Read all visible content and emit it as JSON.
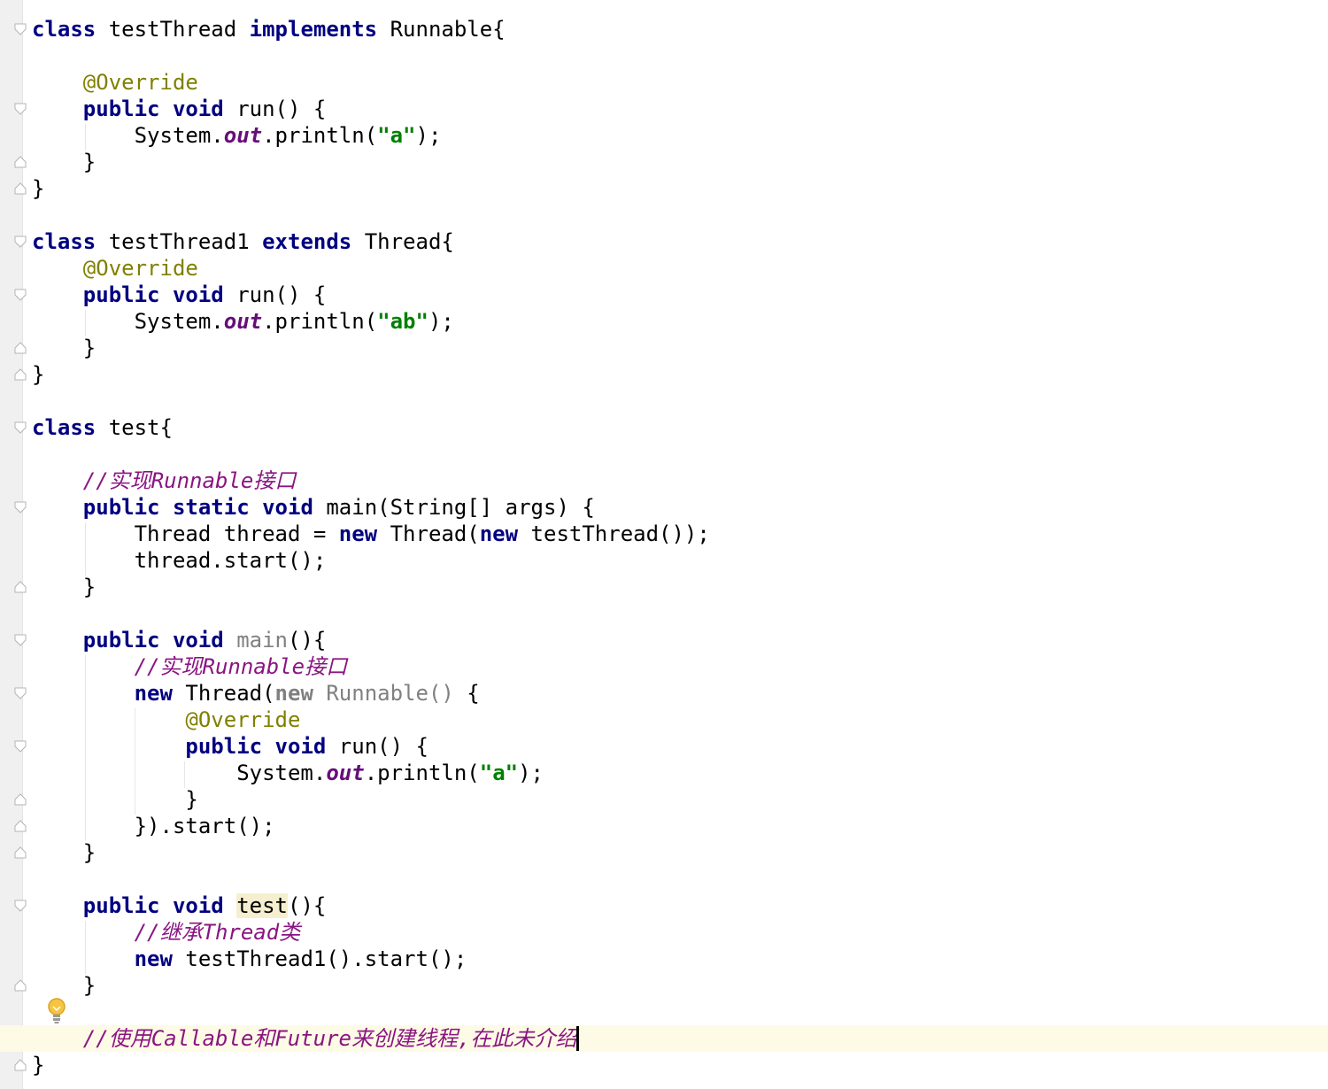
{
  "code": {
    "l1": {
      "kw1": "class",
      "t1": " testThread ",
      "kw2": "implements",
      "t2": " Runnable{"
    },
    "l3": {
      "ann": "@Override"
    },
    "l4": {
      "kw1": "public",
      "sp": " ",
      "kw2": "void",
      "t": " run() {"
    },
    "l5": {
      "t1": "System.",
      "field": "out",
      "t2": ".println(",
      "str": "\"a\"",
      "t3": ");"
    },
    "l6": {
      "t": "}"
    },
    "l7": {
      "t": "}"
    },
    "l9": {
      "kw1": "class",
      "t1": " testThread1 ",
      "kw2": "extends",
      "t2": " Thread{"
    },
    "l10": {
      "ann": "@Override"
    },
    "l11": {
      "kw1": "public",
      "sp": " ",
      "kw2": "void",
      "t": " run() {"
    },
    "l12": {
      "t1": "System.",
      "field": "out",
      "t2": ".println(",
      "str": "\"ab\"",
      "t3": ");"
    },
    "l13": {
      "t": "}"
    },
    "l14": {
      "t": "}"
    },
    "l16": {
      "kw1": "class",
      "t1": " test{"
    },
    "l18": {
      "cmt": "//实现Runnable接口"
    },
    "l19": {
      "kw1": "public",
      "kw2": "static",
      "kw3": "void",
      "t": " main(String[] args) {"
    },
    "l20": {
      "t1": "Thread thread = ",
      "kw1": "new",
      "t2": " Thread(",
      "kw2": "new",
      "t3": " testThread());"
    },
    "l21": {
      "t": "thread.start();"
    },
    "l22": {
      "t": "}"
    },
    "l24": {
      "kw1": "public",
      "kw2": "void",
      "gray": "main",
      "t": "(){"
    },
    "l25": {
      "cmt": "//实现Runnable接口"
    },
    "l26": {
      "kw1": "new",
      "t1": " Thread(",
      "gray1": "new",
      "gray2": " Runnable()",
      "t2": " {"
    },
    "l27": {
      "ann": "@Override"
    },
    "l28": {
      "kw1": "public",
      "kw2": "void",
      "t": " run() {"
    },
    "l29": {
      "t1": "System.",
      "field": "out",
      "t2": ".println(",
      "str": "\"a\"",
      "t3": ");"
    },
    "l30": {
      "t": "}"
    },
    "l31": {
      "t": "}).start();"
    },
    "l32": {
      "t": "}"
    },
    "l34": {
      "kw1": "public",
      "kw2": "void",
      "hl": "test",
      "t": "(){"
    },
    "l35": {
      "cmt": "//继承Thread类"
    },
    "l36": {
      "kw1": "new",
      "t": " testThread1().start();"
    },
    "l37": {
      "t": "}"
    },
    "l39": {
      "cmt": "//使用Callable和Future来创建线程,在此未介绍"
    },
    "l40": {
      "t": "}"
    }
  },
  "icons": {
    "fold": "fold-marker-icon",
    "bulb": "lightbulb-icon"
  },
  "colors": {
    "keyword": "#000080",
    "annotation": "#808000",
    "string": "#008000",
    "field": "#660e7a",
    "comment": "#8a1582",
    "current_line": "#fdfae6",
    "gutter": "#f0f0f0"
  }
}
